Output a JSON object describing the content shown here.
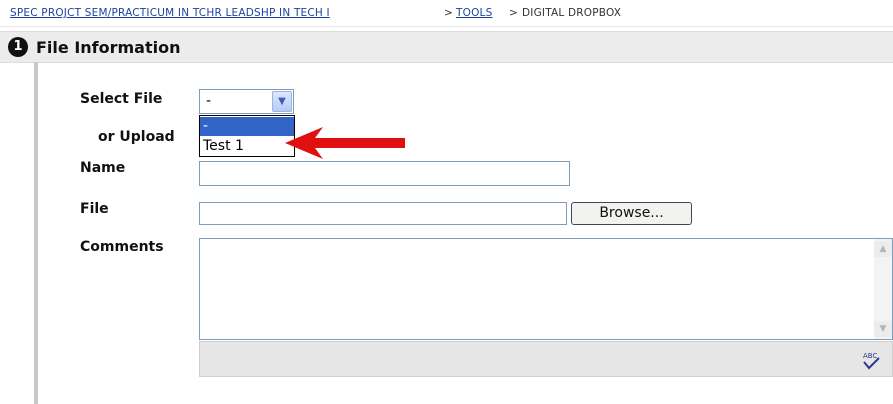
{
  "breadcrumb": {
    "course": "SPEC PROJCT SEM/PRACTICUM IN TCHR LEADSHP IN TECH I",
    "sep1": ">",
    "tools": "TOOLS",
    "sep2": ">",
    "current": "DIGITAL DROPBOX"
  },
  "section": {
    "step": "1",
    "title": "File Information"
  },
  "form": {
    "select_file_label": "Select File",
    "select_value": "-",
    "options": [
      "-",
      "Test 1"
    ],
    "or_upload_label": "or Upload",
    "name_label": "Name",
    "name_value": "",
    "file_label": "File",
    "file_value": "",
    "browse_label": "Browse...",
    "comments_label": "Comments",
    "comments_value": "",
    "spellcheck_text": "ABC"
  },
  "colors": {
    "link": "#1a44a0",
    "selected_option": "#3264c8",
    "annotation_arrow": "#e01010"
  },
  "icons": [
    "chevron-down-icon",
    "scroll-up-icon",
    "scroll-down-icon",
    "spellcheck-icon",
    "red-arrow-icon"
  ]
}
